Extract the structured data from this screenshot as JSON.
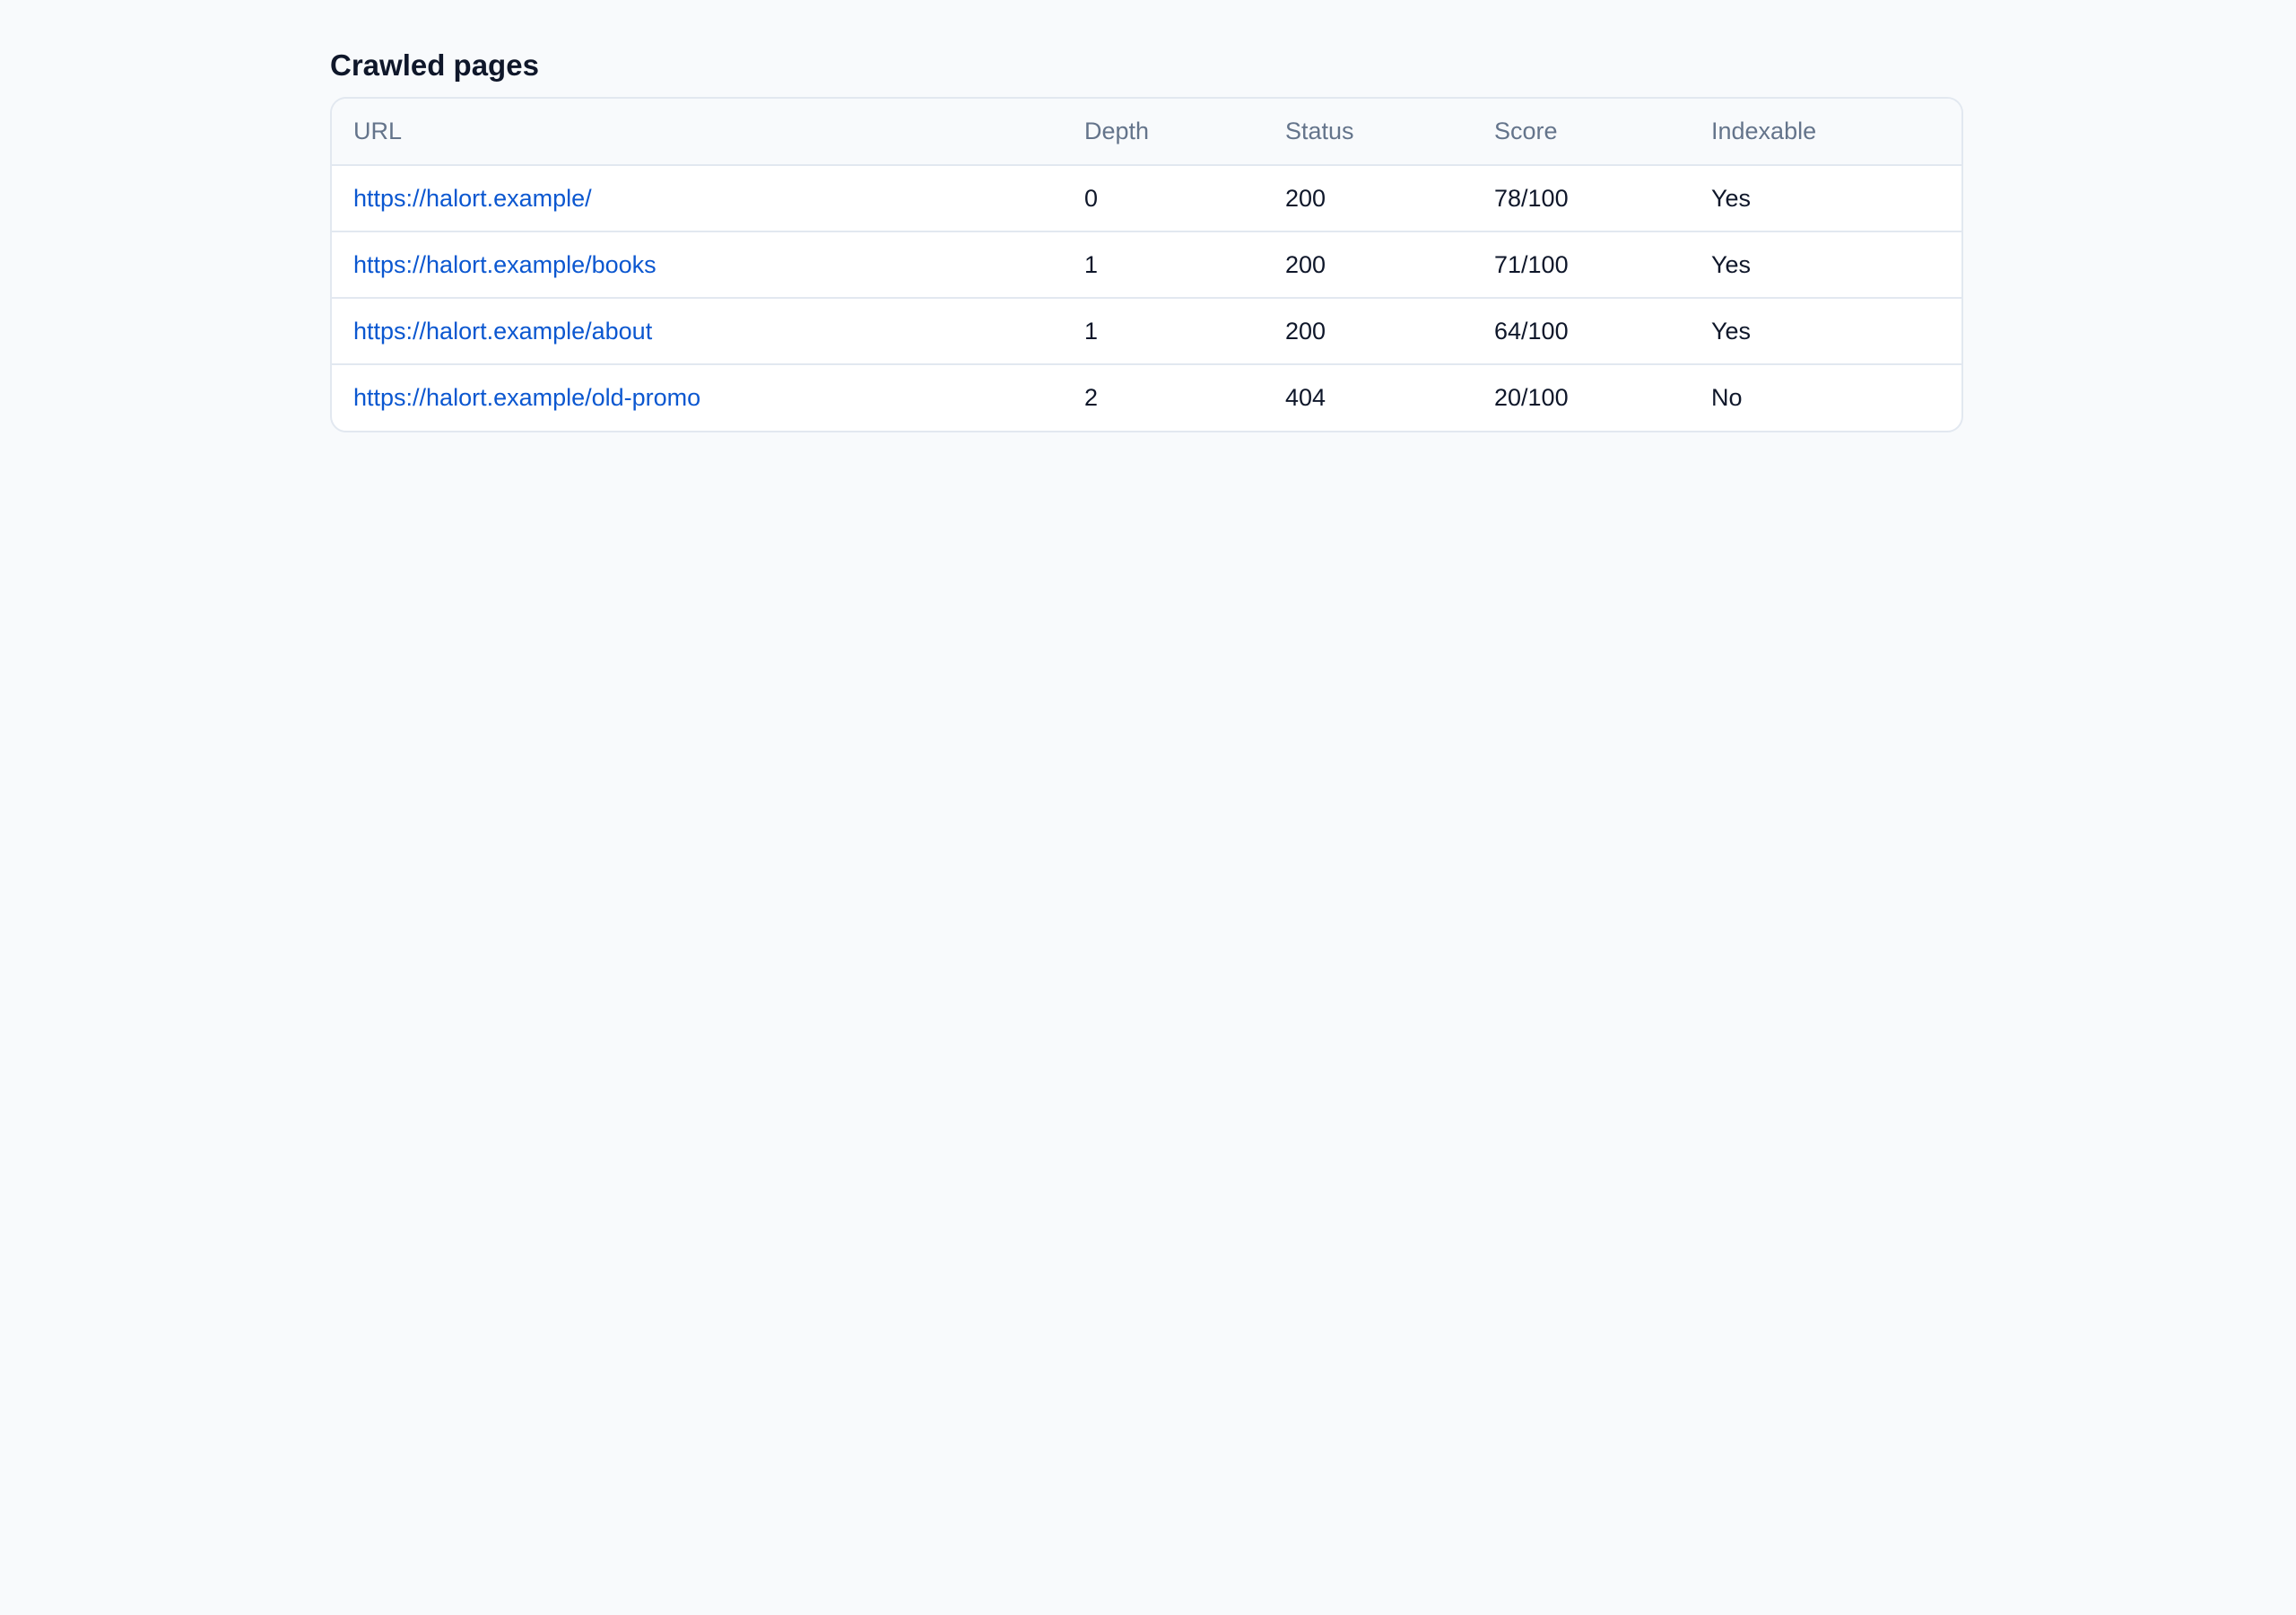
{
  "page": {
    "title": "Crawled pages"
  },
  "table": {
    "headers": {
      "url": "URL",
      "depth": "Depth",
      "status": "Status",
      "score": "Score",
      "indexable": "Indexable"
    },
    "rows": [
      {
        "url": "https://halort.example/",
        "depth": "0",
        "status": "200",
        "score": "78/100",
        "indexable": "Yes"
      },
      {
        "url": "https://halort.example/books",
        "depth": "1",
        "status": "200",
        "score": "71/100",
        "indexable": "Yes"
      },
      {
        "url": "https://halort.example/about",
        "depth": "1",
        "status": "200",
        "score": "64/100",
        "indexable": "Yes"
      },
      {
        "url": "https://halort.example/old-promo",
        "depth": "2",
        "status": "404",
        "score": "20/100",
        "indexable": "No"
      }
    ]
  },
  "colors": {
    "background": "#f8fafc",
    "link": "#0b57d0",
    "header_text": "#64748b",
    "body_text": "#0f172a",
    "border": "#e2e8f0"
  }
}
